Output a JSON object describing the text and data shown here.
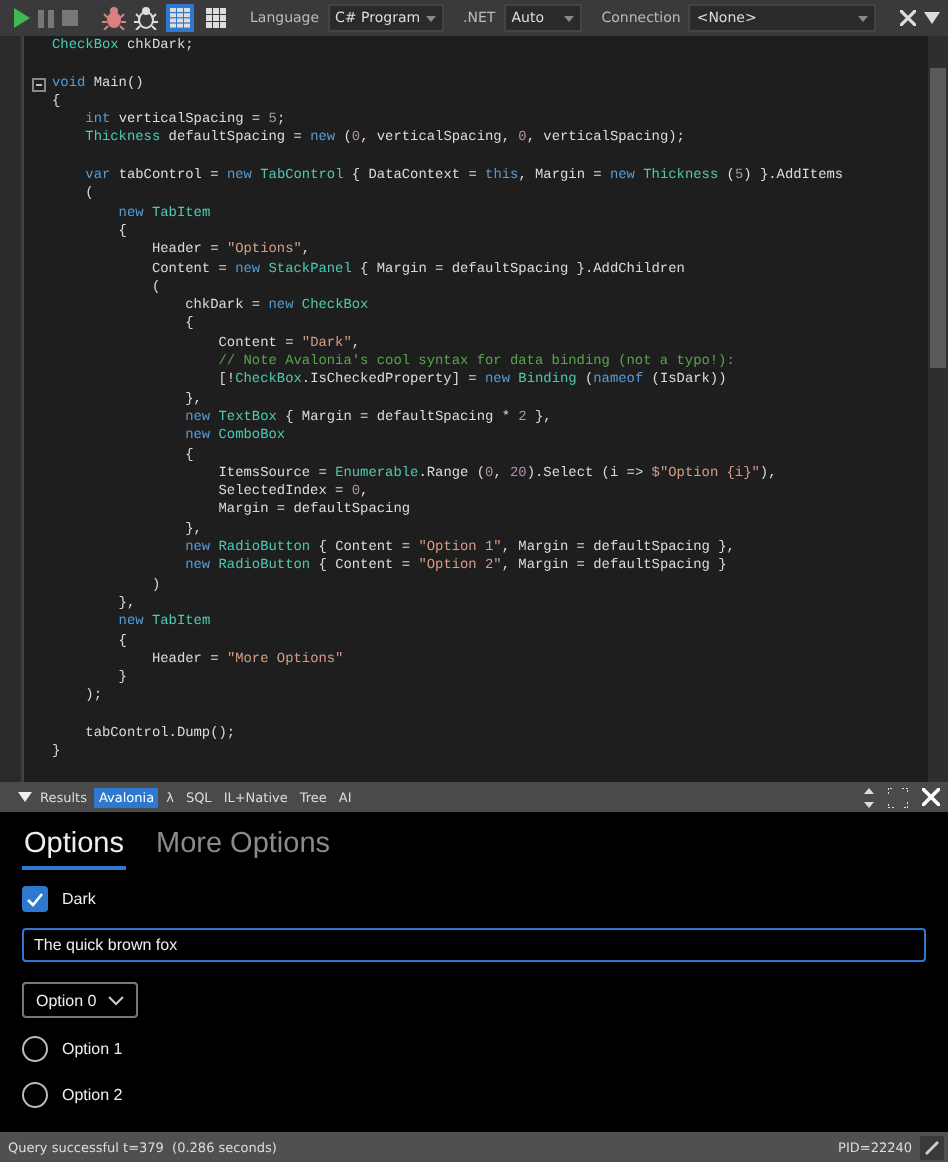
{
  "toolbar": {
    "view_buttons": [
      {
        "kind": "list",
        "selected": true
      },
      {
        "kind": "grid",
        "selected": false
      }
    ],
    "language_label": "Language",
    "language": "C# Program",
    "framework_label": ".NET",
    "framework": "Auto",
    "connection_label": "Connection",
    "connection": "<None>"
  },
  "code": [
    {
      "kind": "code",
      "segments": [
        {
          "text": "CheckBox",
          "kind": "type"
        },
        {
          "text": " chkDark;",
          "kind": "plain"
        }
      ]
    },
    {
      "kind": "blank"
    },
    {
      "kind": "fold",
      "segments": [
        {
          "text": "void",
          "kind": "kw"
        },
        {
          "text": " Main()",
          "kind": "plain"
        }
      ]
    },
    {
      "kind": "code",
      "segments": [
        {
          "text": "{",
          "kind": "plain"
        }
      ]
    },
    {
      "kind": "code",
      "segments": [
        {
          "text": "    int",
          "kind": "kw"
        },
        {
          "text": " verticalSpacing = ",
          "kind": "plain"
        },
        {
          "text": "5",
          "kind": "num"
        },
        {
          "text": ";",
          "kind": "plain"
        }
      ]
    },
    {
      "kind": "code",
      "segments": [
        {
          "text": "    Thickness",
          "kind": "type"
        },
        {
          "text": " defaultSpacing = ",
          "kind": "plain"
        },
        {
          "text": "new",
          "kind": "kw"
        },
        {
          "text": " (",
          "kind": "plain"
        },
        {
          "text": "0",
          "kind": "num"
        },
        {
          "text": ", verticalSpacing, ",
          "kind": "plain"
        },
        {
          "text": "0",
          "kind": "num"
        },
        {
          "text": ", verticalSpacing);",
          "kind": "plain"
        }
      ]
    },
    {
      "kind": "blank"
    },
    {
      "kind": "code",
      "segments": [
        {
          "text": "    var",
          "kind": "kw"
        },
        {
          "text": " tabControl = ",
          "kind": "plain"
        },
        {
          "text": "new",
          "kind": "kw"
        },
        {
          "text": " TabControl",
          "kind": "type"
        },
        {
          "text": " { DataContext = ",
          "kind": "plain"
        },
        {
          "text": "this",
          "kind": "kw"
        },
        {
          "text": ", Margin = ",
          "kind": "plain"
        },
        {
          "text": "new",
          "kind": "kw"
        },
        {
          "text": " Thickness",
          "kind": "type"
        },
        {
          "text": " (",
          "kind": "plain"
        },
        {
          "text": "5",
          "kind": "num"
        },
        {
          "text": ") }.AddItems",
          "kind": "plain"
        }
      ]
    },
    {
      "kind": "code",
      "segments": [
        {
          "text": "    (",
          "kind": "plain"
        }
      ]
    },
    {
      "kind": "code",
      "segments": [
        {
          "text": "        new",
          "kind": "kw"
        },
        {
          "text": " TabItem",
          "kind": "type"
        }
      ]
    },
    {
      "kind": "code",
      "segments": [
        {
          "text": "        {",
          "kind": "plain"
        }
      ]
    },
    {
      "kind": "code",
      "segments": [
        {
          "text": "            Header = ",
          "kind": "plain"
        },
        {
          "text": "\"Options\"",
          "kind": "str"
        },
        {
          "text": ",",
          "kind": "plain"
        }
      ]
    },
    {
      "kind": "code",
      "segments": [
        {
          "text": "            Content = ",
          "kind": "plain"
        },
        {
          "text": "new",
          "kind": "kw"
        },
        {
          "text": " StackPanel",
          "kind": "type"
        },
        {
          "text": " { Margin = defaultSpacing }.AddChildren",
          "kind": "plain"
        }
      ]
    },
    {
      "kind": "code",
      "segments": [
        {
          "text": "            (",
          "kind": "plain"
        }
      ]
    },
    {
      "kind": "code",
      "segments": [
        {
          "text": "                chkDark = ",
          "kind": "plain"
        },
        {
          "text": "new",
          "kind": "kw"
        },
        {
          "text": " CheckBox",
          "kind": "type"
        }
      ]
    },
    {
      "kind": "code",
      "segments": [
        {
          "text": "                {",
          "kind": "plain"
        }
      ]
    },
    {
      "kind": "code",
      "segments": [
        {
          "text": "                    Content = ",
          "kind": "plain"
        },
        {
          "text": "\"Dark\"",
          "kind": "str"
        },
        {
          "text": ",",
          "kind": "plain"
        }
      ]
    },
    {
      "kind": "code",
      "segments": [
        {
          "text": "                    // Note Avalonia's cool syntax for data binding (not a typo!):",
          "kind": "cmt"
        }
      ]
    },
    {
      "kind": "code",
      "segments": [
        {
          "text": "                    [!",
          "kind": "plain"
        },
        {
          "text": "CheckBox",
          "kind": "type"
        },
        {
          "text": ".IsCheckedProperty] = ",
          "kind": "plain"
        },
        {
          "text": "new",
          "kind": "kw"
        },
        {
          "text": " Binding",
          "kind": "type"
        },
        {
          "text": " (",
          "kind": "plain"
        },
        {
          "text": "nameof",
          "kind": "kw"
        },
        {
          "text": " (IsDark))",
          "kind": "plain"
        }
      ]
    },
    {
      "kind": "code",
      "segments": [
        {
          "text": "                },",
          "kind": "plain"
        }
      ]
    },
    {
      "kind": "code",
      "segments": [
        {
          "text": "                new",
          "kind": "kw"
        },
        {
          "text": " TextBox",
          "kind": "type"
        },
        {
          "text": " { Margin = defaultSpacing * ",
          "kind": "plain"
        },
        {
          "text": "2",
          "kind": "num"
        },
        {
          "text": " },",
          "kind": "plain"
        }
      ]
    },
    {
      "kind": "code",
      "segments": [
        {
          "text": "                new",
          "kind": "kw"
        },
        {
          "text": " ComboBox",
          "kind": "type"
        }
      ]
    },
    {
      "kind": "code",
      "segments": [
        {
          "text": "                {",
          "kind": "plain"
        }
      ]
    },
    {
      "kind": "code",
      "segments": [
        {
          "text": "                    ItemsSource = ",
          "kind": "plain"
        },
        {
          "text": "Enumerable",
          "kind": "type"
        },
        {
          "text": ".Range (",
          "kind": "plain"
        },
        {
          "text": "0",
          "kind": "num"
        },
        {
          "text": ", ",
          "kind": "plain"
        },
        {
          "text": "20",
          "kind": "num"
        },
        {
          "text": ").Select (i => ",
          "kind": "plain"
        },
        {
          "text": "$\"Option {i}\"",
          "kind": "str"
        },
        {
          "text": "),",
          "kind": "plain"
        }
      ]
    },
    {
      "kind": "code",
      "segments": [
        {
          "text": "                    SelectedIndex = ",
          "kind": "plain"
        },
        {
          "text": "0",
          "kind": "num"
        },
        {
          "text": ",",
          "kind": "plain"
        }
      ]
    },
    {
      "kind": "code",
      "segments": [
        {
          "text": "                    Margin = defaultSpacing",
          "kind": "plain"
        }
      ]
    },
    {
      "kind": "code",
      "segments": [
        {
          "text": "                },",
          "kind": "plain"
        }
      ]
    },
    {
      "kind": "code",
      "segments": [
        {
          "text": "                new",
          "kind": "kw"
        },
        {
          "text": " RadioButton",
          "kind": "type"
        },
        {
          "text": " { Content = ",
          "kind": "plain"
        },
        {
          "text": "\"Option 1\"",
          "kind": "str"
        },
        {
          "text": ", Margin = defaultSpacing },",
          "kind": "plain"
        }
      ]
    },
    {
      "kind": "code",
      "segments": [
        {
          "text": "                new",
          "kind": "kw"
        },
        {
          "text": " RadioButton",
          "kind": "type"
        },
        {
          "text": " { Content = ",
          "kind": "plain"
        },
        {
          "text": "\"Option 2\"",
          "kind": "str"
        },
        {
          "text": ", Margin = defaultSpacing }",
          "kind": "plain"
        }
      ]
    },
    {
      "kind": "code",
      "segments": [
        {
          "text": "            )",
          "kind": "plain"
        }
      ]
    },
    {
      "kind": "code",
      "segments": [
        {
          "text": "        },",
          "kind": "plain"
        }
      ]
    },
    {
      "kind": "code",
      "segments": [
        {
          "text": "        new",
          "kind": "kw"
        },
        {
          "text": " TabItem",
          "kind": "type"
        }
      ]
    },
    {
      "kind": "code",
      "segments": [
        {
          "text": "        {",
          "kind": "plain"
        }
      ]
    },
    {
      "kind": "code",
      "segments": [
        {
          "text": "            Header = ",
          "kind": "plain"
        },
        {
          "text": "\"More Options\"",
          "kind": "str"
        }
      ]
    },
    {
      "kind": "code",
      "segments": [
        {
          "text": "        }",
          "kind": "plain"
        }
      ]
    },
    {
      "kind": "code",
      "segments": [
        {
          "text": "    );",
          "kind": "plain"
        }
      ]
    },
    {
      "kind": "blank"
    },
    {
      "kind": "code",
      "segments": [
        {
          "text": "    tabControl.Dump();",
          "kind": "plain"
        }
      ]
    },
    {
      "kind": "code",
      "segments": [
        {
          "text": "}",
          "kind": "plain"
        }
      ]
    }
  ],
  "output_tabs": [
    {
      "label": "Results",
      "selected": false
    },
    {
      "label": "Avalonia",
      "selected": true
    },
    {
      "label": "λ",
      "selected": false
    },
    {
      "label": "SQL",
      "selected": false
    },
    {
      "label": "IL+Native",
      "selected": false
    },
    {
      "label": "Tree",
      "selected": false
    },
    {
      "label": "AI",
      "selected": false
    }
  ],
  "preview": {
    "tabs": [
      {
        "label": "Options",
        "selected": true
      },
      {
        "label": "More Options",
        "selected": false
      }
    ],
    "checkbox": {
      "label": "Dark",
      "checked": true
    },
    "textbox": {
      "value": "The quick brown fox"
    },
    "combobox": {
      "value": "Option 0"
    },
    "radios": [
      {
        "label": "Option 1",
        "selected": false
      },
      {
        "label": "Option 2",
        "selected": false
      }
    ]
  },
  "status_bar": {
    "message": "Query successful t=379  (0.286 seconds)",
    "pid": "PID=22240"
  }
}
